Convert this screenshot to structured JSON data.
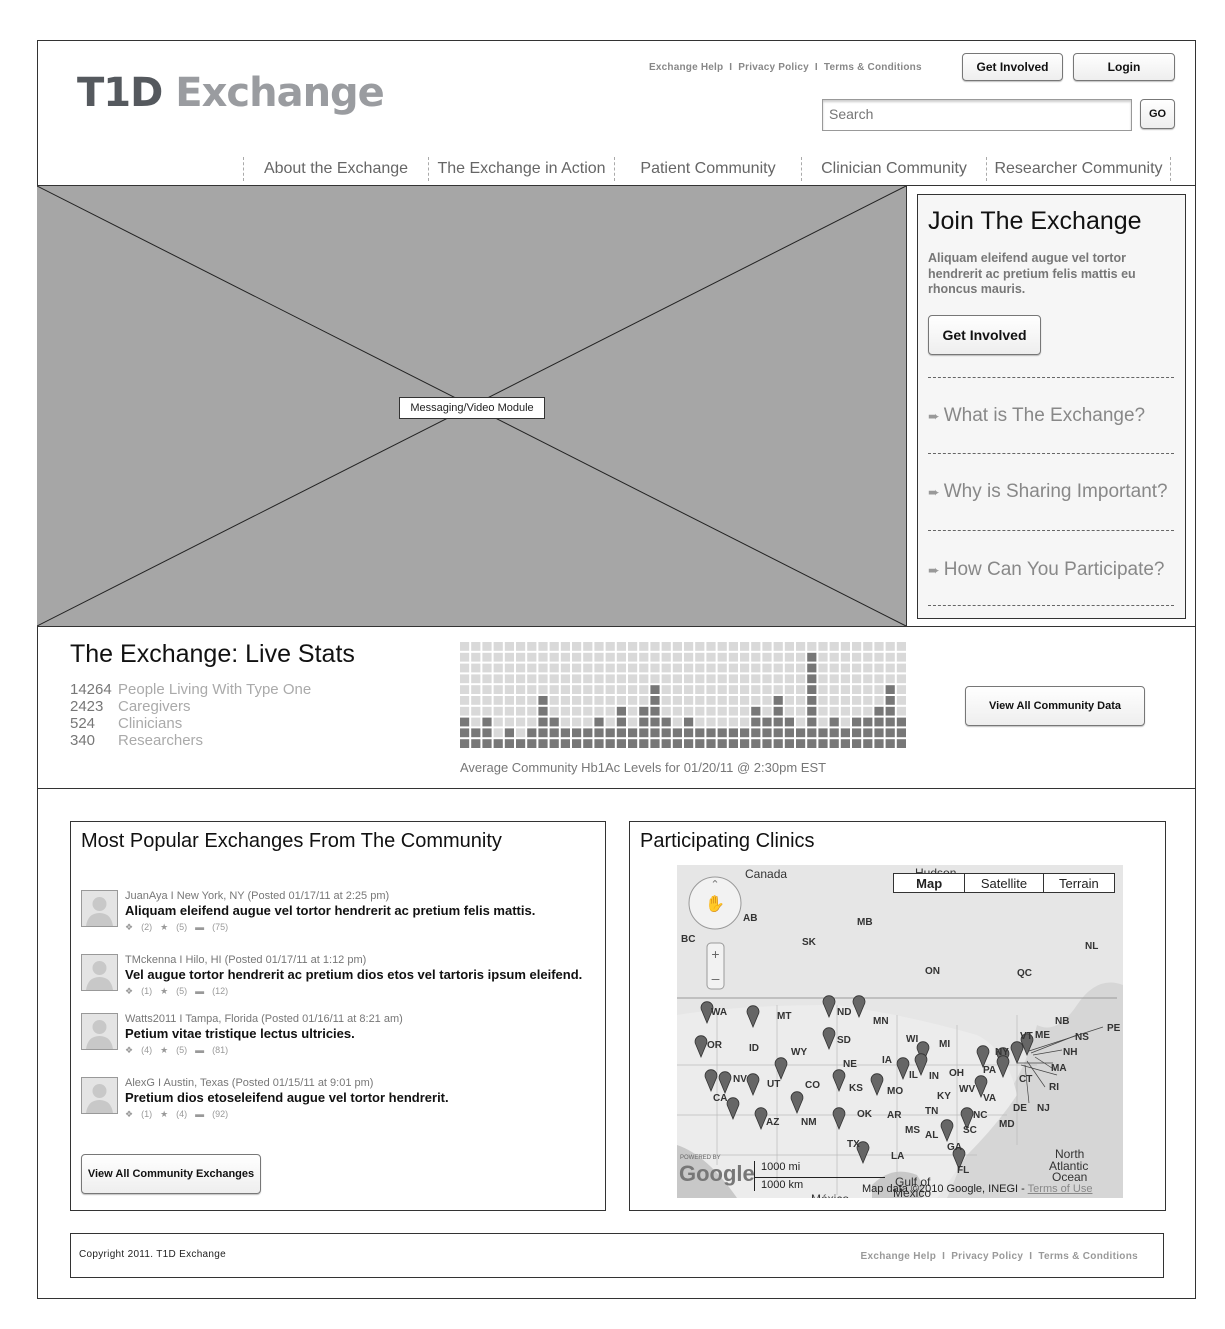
{
  "header": {
    "logo_part1": "T1D",
    "logo_part2": "Exchange",
    "top_links": [
      "Exchange Help",
      "Privacy Policy",
      "Terms & Conditions"
    ],
    "link_separator": "I",
    "get_involved": "Get Involved",
    "login": "Login",
    "search_placeholder": "Search",
    "go": "GO"
  },
  "nav": [
    "About the Exchange",
    "The Exchange in Action",
    "Patient Community",
    "Clinician Community",
    "Researcher Community"
  ],
  "video": {
    "label": "Messaging/Video Module"
  },
  "join": {
    "title": "Join The Exchange",
    "description": "Aliquam eleifend augue vel tortor hendrerit ac pretium felis mattis eu rhoncus mauris.",
    "button": "Get Involved",
    "questions": [
      "What is The Exchange?",
      "Why is Sharing Important?",
      "How Can You Participate?"
    ]
  },
  "stats": {
    "title": "The Exchange: Live Stats",
    "items": [
      {
        "num": "14264",
        "label": "People Living With Type One"
      },
      {
        "num": "2423",
        "label": "Caregivers"
      },
      {
        "num": "524",
        "label": "Clinicians"
      },
      {
        "num": "340",
        "label": "Researchers"
      }
    ],
    "column_levels": [
      3,
      2,
      3,
      1,
      2,
      1,
      2,
      5,
      3,
      2,
      2,
      2,
      3,
      2,
      4,
      2,
      4,
      6,
      3,
      2,
      3,
      2,
      2,
      2,
      2,
      2,
      4,
      3,
      5,
      3,
      2,
      9,
      2,
      3,
      2,
      3,
      3,
      4,
      6,
      3
    ],
    "caption": "Average Community Hb1Ac Levels for 01/20/11 @ 2:30pm EST",
    "button": "View All Community Data"
  },
  "popular": {
    "title": "Most Popular Exchanges From The Community",
    "posts": [
      {
        "meta": "JuanAya I New York, NY (Posted 01/17/11 at 2:25 pm)",
        "title": "Aliquam eleifend augue vel tortor hendrerit ac pretium felis mattis.",
        "c1": "(2)",
        "c2": "(5)",
        "c3": "(75)"
      },
      {
        "meta": "TMckenna I Hilo, HI (Posted 01/17/11 at 1:12 pm)",
        "title": "Vel augue tortor hendrerit ac pretium dios etos vel tartoris ipsum eleifend.",
        "c1": "(1)",
        "c2": "(5)",
        "c3": "(12)"
      },
      {
        "meta": "Watts2011 I Tampa, Florida (Posted 01/16/11 at 8:21 am)",
        "title": "Petium vitae tristique lectus ultricies.",
        "c1": "(4)",
        "c2": "(5)",
        "c3": "(81)"
      },
      {
        "meta": "AlexG I Austin, Texas (Posted 01/15/11 at 9:01 pm)",
        "title": "Pretium dios etoseleifend augue vel tortor hendrerit.",
        "c1": "(1)",
        "c2": "(4)",
        "c3": "(92)"
      }
    ],
    "button": "View All Community Exchanges"
  },
  "clinics": {
    "title": "Participating Clinics",
    "map_tabs": [
      "Map",
      "Satellite",
      "Terrain"
    ],
    "labels": [
      "Canada",
      "Hudson",
      "AB",
      "MB",
      "BC",
      "SK",
      "NL",
      "ON",
      "QC",
      "WA",
      "MT",
      "ND",
      "MN",
      "NB",
      "PE",
      "OR",
      "ID",
      "SD",
      "WI",
      "MI",
      "VT",
      "ME",
      "NS",
      "NH",
      "WY",
      "NE",
      "IA",
      "NY",
      "MA",
      "NV",
      "UT",
      "CO",
      "KS",
      "MO",
      "IL",
      "IN",
      "OH",
      "PA",
      "CT",
      "RI",
      "CA",
      "OK",
      "AR",
      "KY",
      "WV",
      "VA",
      "DE",
      "NJ",
      "AZ",
      "NM",
      "TN",
      "NC",
      "MD",
      "TX",
      "MS",
      "AL",
      "GA",
      "SC",
      "LA",
      "FL",
      "North",
      "Atlantic",
      "Ocean",
      "Gulf of",
      "Mexico",
      "México"
    ],
    "powered_by": "POWERED BY",
    "google": "Google",
    "scale_mi": "1000 mi",
    "scale_km": "1000 km",
    "map_data": "Map data ©2010 Google, INEGI -",
    "terms": "Terms of Use"
  },
  "footer": {
    "copyright": "Copyright 2011.  T1D Exchange",
    "links": [
      "Exchange Help",
      "Privacy Policy",
      "Terms & Conditions"
    ],
    "separator": "I"
  }
}
